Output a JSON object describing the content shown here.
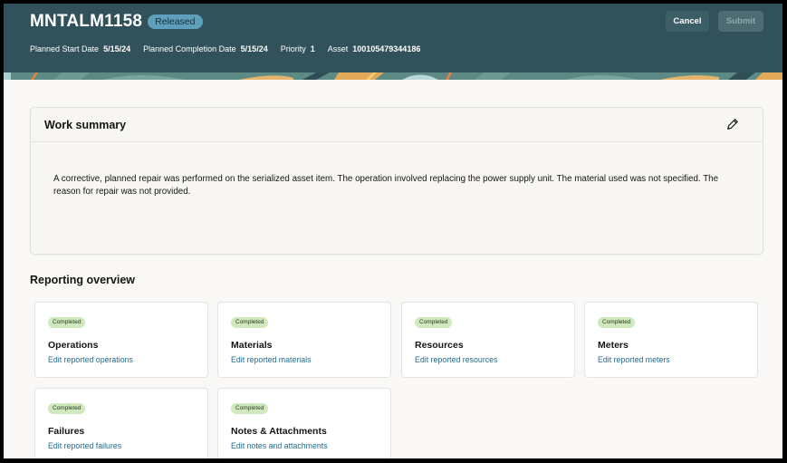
{
  "header": {
    "title": "MNTALM1158",
    "status": "Released",
    "meta": [
      {
        "label": "Planned Start Date",
        "value": "5/15/24"
      },
      {
        "label": "Planned Completion Date",
        "value": "5/15/24"
      },
      {
        "label": "Priority",
        "value": "1"
      },
      {
        "label": "Asset",
        "value": "100105479344186"
      }
    ],
    "cancel_label": "Cancel",
    "submit_label": "Submit"
  },
  "work_summary": {
    "title": "Work summary",
    "edit_icon": "pencil-icon",
    "text": "A corrective, planned repair was performed on the serialized asset item. The operation involved replacing the power supply unit. The material used was not specified. The reason for repair was not provided."
  },
  "reporting_overview": {
    "title": "Reporting overview",
    "tiles": [
      {
        "status": "Completed",
        "title": "Operations",
        "link": "Edit reported operations"
      },
      {
        "status": "Completed",
        "title": "Materials",
        "link": "Edit reported materials"
      },
      {
        "status": "Completed",
        "title": "Resources",
        "link": "Edit reported resources"
      },
      {
        "status": "Completed",
        "title": "Meters",
        "link": "Edit reported meters"
      },
      {
        "status": "Completed",
        "title": "Failures",
        "link": "Edit reported failures"
      },
      {
        "status": "Completed",
        "title": "Notes & Attachments",
        "link": "Edit notes and attachments"
      }
    ]
  },
  "colors": {
    "header_bg": "#31525a",
    "status_pill": "#5e9fbb",
    "completed_badge": "#cfe8bc",
    "link": "#1f6b8c"
  }
}
